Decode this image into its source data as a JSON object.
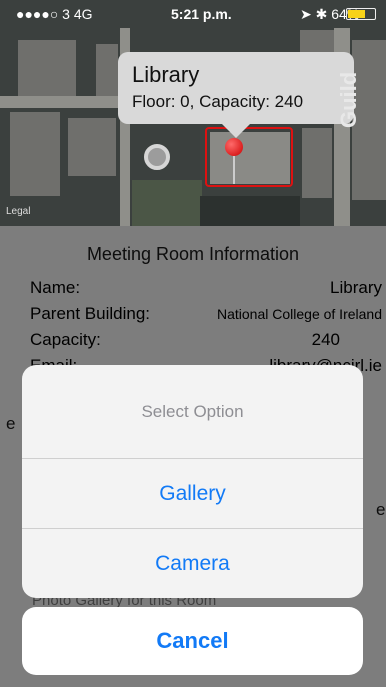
{
  "status_bar": {
    "carrier": "●●●●○ 3  4G",
    "time": "5:21 p.m.",
    "battery": "64%",
    "battery_level": 0.64
  },
  "map": {
    "callout_title": "Library",
    "callout_subtitle": "Floor: 0, Capacity: 240",
    "street_label": "Guild",
    "legal": "Legal"
  },
  "info": {
    "heading": "Meeting Room Information",
    "rows": [
      {
        "label": "Name:",
        "value": "Library"
      },
      {
        "label": "Parent Building:",
        "value": "National College of Ireland"
      },
      {
        "label": "Capacity:",
        "value": "240"
      },
      {
        "label": "Email:",
        "value": "library@ncirl.ie"
      }
    ],
    "cut_left": "e",
    "cut_right": "e",
    "photo_gallery_text": "Photo Gallery for this Room"
  },
  "action_sheet": {
    "title": "Select Option",
    "options": [
      "Gallery",
      "Camera"
    ],
    "cancel": "Cancel"
  }
}
